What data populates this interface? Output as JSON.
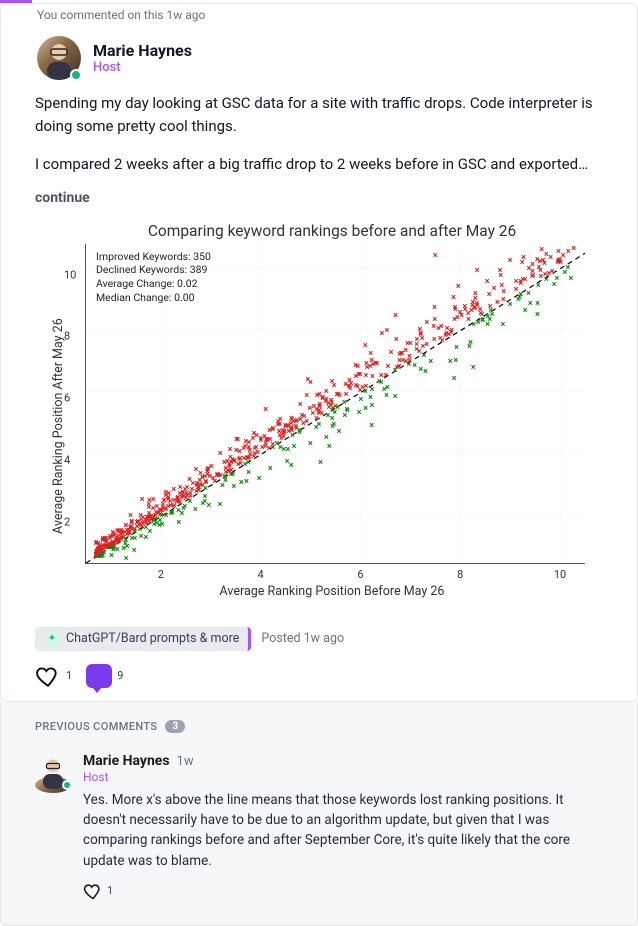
{
  "notice": "You commented on this 1w ago",
  "author": {
    "name": "Marie Haynes",
    "role": "Host"
  },
  "post": {
    "p1": "Spending my day looking at GSC data for a site with traffic drops. Code interpreter is doing some pretty cool things.",
    "p2": "I compared 2 weeks after a big traffic drop to 2 weeks before in GSC and exported…",
    "continue": "continue"
  },
  "tag": {
    "label": "ChatGPT/Bard prompts & more",
    "icon": "✦"
  },
  "posted": "Posted 1w ago",
  "actions": {
    "likes": "1",
    "comments": "9"
  },
  "prev": {
    "label": "PREVIOUS COMMENTS",
    "count": "3"
  },
  "comment": {
    "name": "Marie Haynes",
    "time": "1w",
    "role": "Host",
    "text": "Yes. More x's above the line means that those keywords lost ranking positions. It doesn't necessarily have to be due to an algorithm update, but given that I was comparing rankings before and after September Core, it's quite likely that the core update was to blame.",
    "likes": "1"
  },
  "chart_data": {
    "type": "scatter",
    "title": "Comparing keyword rankings before and after May 26",
    "xlabel": "Average Ranking Position Before May 26",
    "ylabel": "Average Ranking Position After May 26",
    "xlim": [
      0.5,
      10.5
    ],
    "ylim": [
      0.5,
      10.8
    ],
    "ticks_x": [
      2,
      4,
      6,
      8,
      10
    ],
    "ticks_y": [
      2,
      4,
      6,
      8,
      10
    ],
    "reference_line": {
      "style": "dashed",
      "from": [
        0.5,
        0.5
      ],
      "to": [
        10.5,
        10.5
      ]
    },
    "annotations": [
      "Improved Keywords: 350",
      "Declined Keywords: 389",
      "Average Change: 0.02",
      "Median Change: 0.00"
    ],
    "series": [
      {
        "name": "Improved (green)",
        "color": "#0a8a0a",
        "marker": "x",
        "approx_count": 350
      },
      {
        "name": "Declined (red)",
        "color": "#e11d1d",
        "marker": "x",
        "approx_count": 389
      }
    ],
    "note": "Points plot each keyword's average rank before vs after; points above the y=x line (red) declined, below (green) improved. Exact per-keyword coordinates are dense and not individually labeled in the image."
  }
}
